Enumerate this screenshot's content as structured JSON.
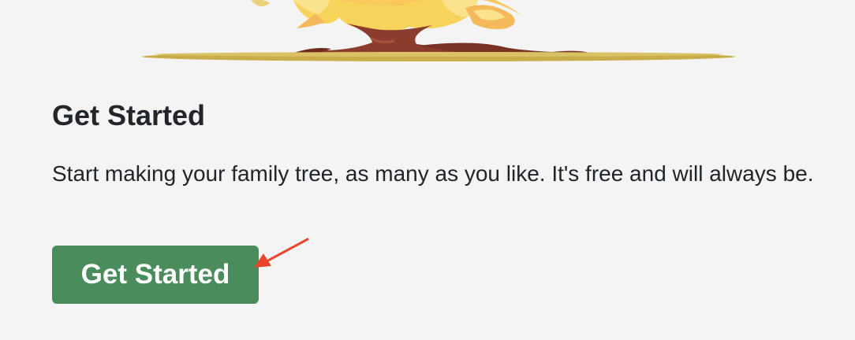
{
  "card": {
    "title": "Get Started",
    "text": "Start making your family tree, as many as you like. It's free and will always be.",
    "button_label": "Get Started"
  },
  "colors": {
    "background": "#f4f4f4",
    "button": "#4a8c5c",
    "arrow": "#e8452c"
  }
}
